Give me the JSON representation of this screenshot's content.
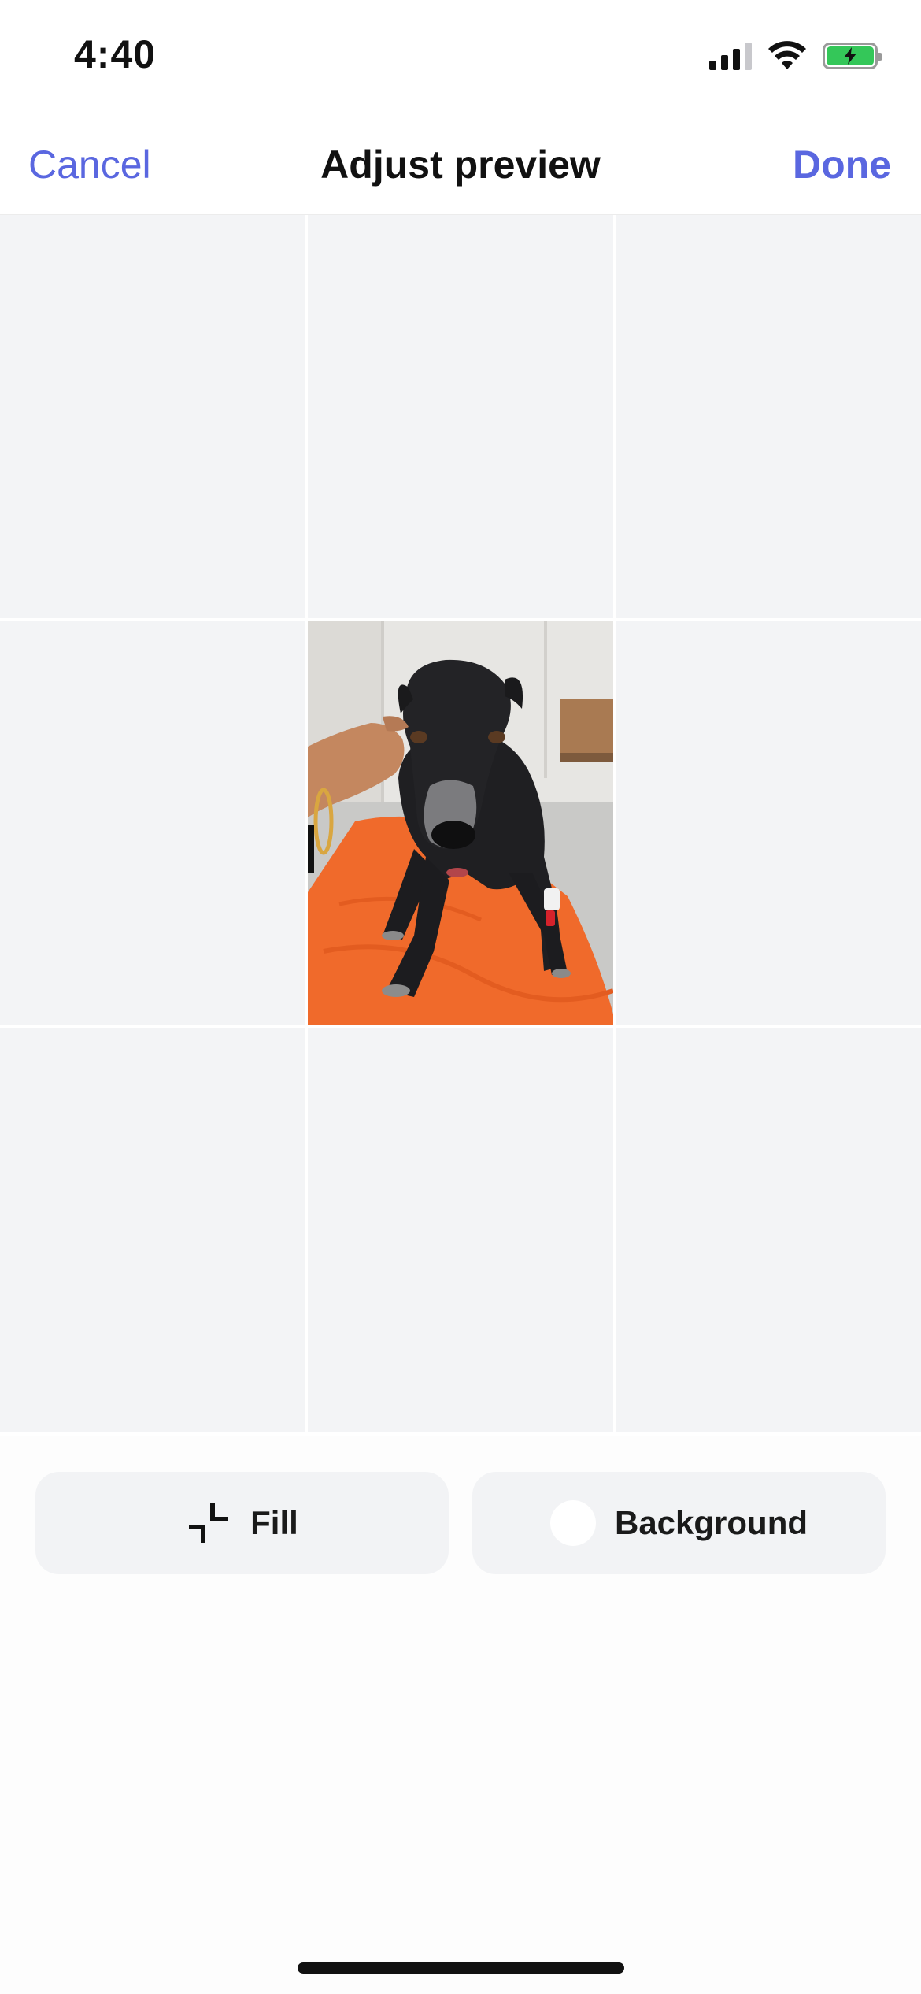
{
  "status_bar": {
    "time": "4:40",
    "icons": [
      "cellular-signal-icon",
      "wifi-icon",
      "battery-charging-icon"
    ],
    "battery_color": "#34c759"
  },
  "nav": {
    "cancel_label": "Cancel",
    "title": "Adjust preview",
    "done_label": "Done",
    "accent_color": "#5a67e0"
  },
  "preview_grid": {
    "rows": 3,
    "columns": 3,
    "photo_subject": "black dog sitting on an orange towel with a hand resting on its head",
    "cell_color": "#f3f4f6"
  },
  "controls": {
    "fill_label": "Fill",
    "fill_icon": "fill-corners-icon",
    "background_label": "Background",
    "background_swatch_color": "#ffffff"
  }
}
